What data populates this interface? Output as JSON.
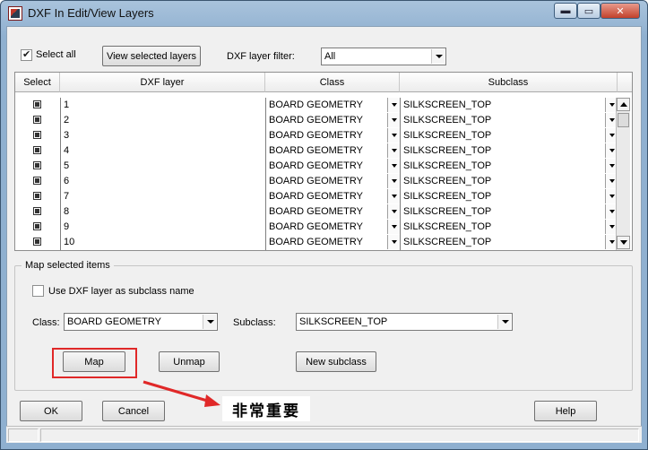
{
  "window": {
    "title": "DXF In Edit/View Layers",
    "min_glyph": "▬",
    "max_glyph": "▭",
    "close_glyph": "✕"
  },
  "toolbar": {
    "select_all_label": "Select all",
    "select_all_checked": true,
    "view_selected_label": "View selected layers",
    "filter_label": "DXF layer filter:",
    "filter_value": "All"
  },
  "grid": {
    "headers": {
      "select": "Select",
      "layer": "DXF layer",
      "class": "Class",
      "subclass": "Subclass"
    },
    "rows": [
      {
        "layer": "1",
        "class": "BOARD GEOMETRY",
        "subclass": "SILKSCREEN_TOP"
      },
      {
        "layer": "2",
        "class": "BOARD GEOMETRY",
        "subclass": "SILKSCREEN_TOP"
      },
      {
        "layer": "3",
        "class": "BOARD GEOMETRY",
        "subclass": "SILKSCREEN_TOP"
      },
      {
        "layer": "4",
        "class": "BOARD GEOMETRY",
        "subclass": "SILKSCREEN_TOP"
      },
      {
        "layer": "5",
        "class": "BOARD GEOMETRY",
        "subclass": "SILKSCREEN_TOP"
      },
      {
        "layer": "6",
        "class": "BOARD GEOMETRY",
        "subclass": "SILKSCREEN_TOP"
      },
      {
        "layer": "7",
        "class": "BOARD GEOMETRY",
        "subclass": "SILKSCREEN_TOP"
      },
      {
        "layer": "8",
        "class": "BOARD GEOMETRY",
        "subclass": "SILKSCREEN_TOP"
      },
      {
        "layer": "9",
        "class": "BOARD GEOMETRY",
        "subclass": "SILKSCREEN_TOP"
      },
      {
        "layer": "10",
        "class": "BOARD GEOMETRY",
        "subclass": "SILKSCREEN_TOP"
      }
    ]
  },
  "map_group": {
    "title": "Map selected items",
    "use_layer_label": "Use DXF layer as subclass name",
    "class_label": "Class:",
    "class_value": "BOARD GEOMETRY",
    "subclass_label": "Subclass:",
    "subclass_value": "SILKSCREEN_TOP",
    "map_label": "Map",
    "unmap_label": "Unmap",
    "new_subclass_label": "New subclass"
  },
  "footer": {
    "ok_label": "OK",
    "cancel_label": "Cancel",
    "help_label": "Help"
  },
  "annotation": {
    "text": "非常重要",
    "color": "#e02828"
  }
}
